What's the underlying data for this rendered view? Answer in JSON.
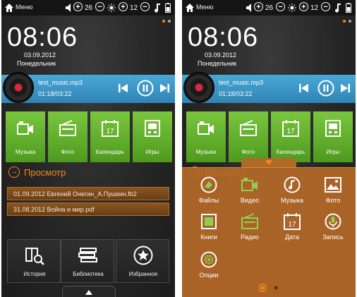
{
  "statusbar": {
    "menu_label": "Меню",
    "volume": "26",
    "brightness": "12"
  },
  "clock": {
    "time": "08:06",
    "date": "03.09.2012",
    "weekday": "Понедельник"
  },
  "player": {
    "track": "test_music.mp3",
    "time": "01:18/03:22"
  },
  "media_tiles": [
    {
      "label": "Музыка",
      "icon": "video-camera-icon"
    },
    {
      "label": "Фото",
      "icon": "radio-icon"
    },
    {
      "label": "Календарь",
      "icon": "calendar-icon"
    },
    {
      "label": "Игры",
      "icon": "game-icon"
    }
  ],
  "calendar_day": "17",
  "recent": {
    "title": "Просмотр",
    "items": [
      "01.09.2012 Евгений Онегин_А.Пушкин.fb2",
      "31.08.2012 Война и мир.pdf"
    ]
  },
  "bottom_tiles": [
    {
      "label": "История",
      "icon": "book-search-icon"
    },
    {
      "label": "Библиотека",
      "icon": "books-stack-icon"
    },
    {
      "label": "Избранное",
      "icon": "star-icon"
    }
  ],
  "apps_menu": [
    {
      "label": "Файлы",
      "icon": "folder-icon"
    },
    {
      "label": "Видео",
      "icon": "video-camera-icon"
    },
    {
      "label": "Музыка",
      "icon": "music-note-icon"
    },
    {
      "label": "Фото",
      "icon": "picture-icon"
    },
    {
      "label": "Книги",
      "icon": "book-icon"
    },
    {
      "label": "Радио",
      "icon": "radio-icon"
    },
    {
      "label": "Дата",
      "icon": "calendar-icon"
    },
    {
      "label": "Запись",
      "icon": "microphone-icon"
    },
    {
      "label": "Опции",
      "icon": "gear-icon"
    }
  ],
  "colors": {
    "accent": "#f28c1c",
    "tile_green": "#63b02e",
    "player_blue": "#3a96c6",
    "overlay_orange": "#b46828"
  }
}
